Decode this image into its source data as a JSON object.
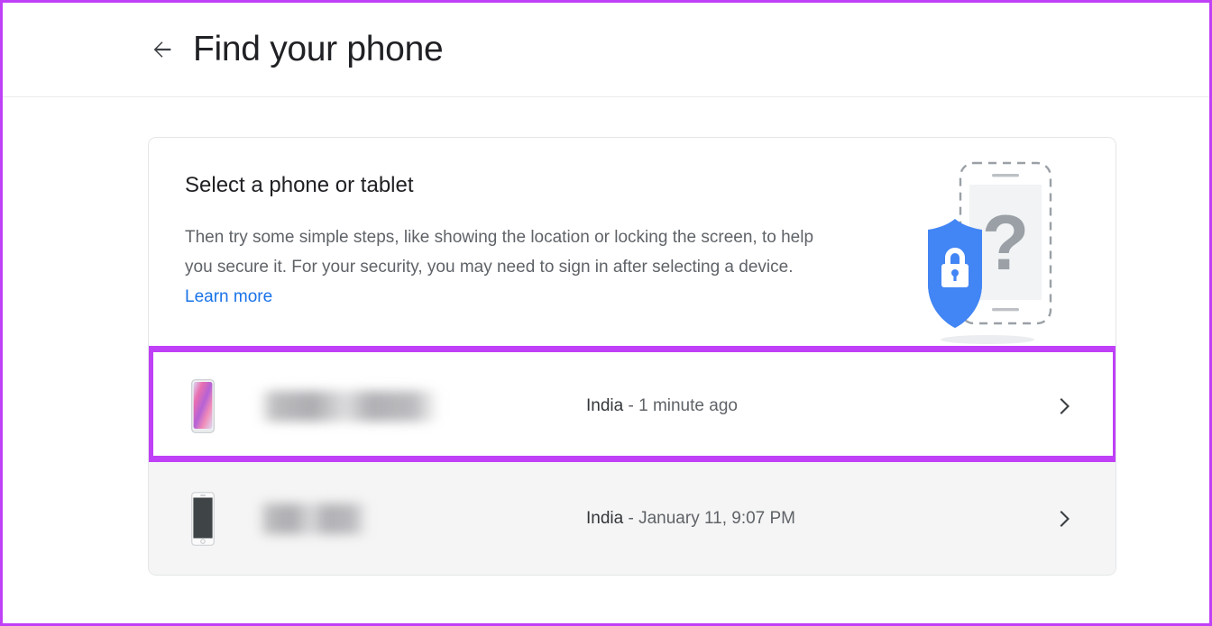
{
  "window": {
    "annotation_border_color": "#bf40f7"
  },
  "header": {
    "back_icon": "arrow-left-icon",
    "title": "Find your phone"
  },
  "card": {
    "heading": "Select a phone or tablet",
    "body_text": "Then try some simple steps, like showing the location or locking the screen, to help you secure it. For your security, you may need to sign in after selecting a device. ",
    "learn_more_label": "Learn more",
    "learn_more_color": "#1a73e8",
    "illustration": {
      "name": "phone-shield-lock-illustration",
      "shield_color": "#4285f4",
      "question_mark": "?"
    }
  },
  "devices": [
    {
      "thumb_icon": "phone-gradient-wallpaper-icon",
      "name_redacted": "",
      "location": "India",
      "separator": "-",
      "last_seen": "1 minute ago",
      "chevron_icon": "chevron-right-icon",
      "highlighted": true
    },
    {
      "thumb_icon": "phone-dark-screen-icon",
      "name_redacted": "",
      "location": "India",
      "separator": "-",
      "last_seen": "January 11, 9:07 PM",
      "chevron_icon": "chevron-right-icon",
      "highlighted": false
    }
  ]
}
